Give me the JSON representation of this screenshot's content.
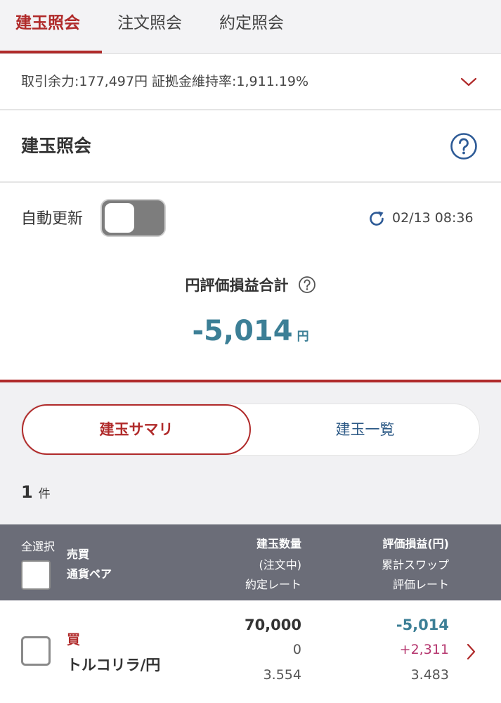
{
  "tabs": [
    {
      "label": "建玉照会",
      "active": true
    },
    {
      "label": "注文照会",
      "active": false
    },
    {
      "label": "約定照会",
      "active": false
    }
  ],
  "margin_info": "取引余力:177,497円 証拠金維持率:1,911.19%",
  "page_title": "建玉照会",
  "auto_update": {
    "label": "自動更新",
    "enabled": false
  },
  "timestamp": "02/13 08:36",
  "total_pl": {
    "label": "円評価損益合計",
    "value": "-5,014",
    "unit": "円"
  },
  "view_toggle": {
    "summary": "建玉サマリ",
    "list": "建玉一覧"
  },
  "count": {
    "value": "1",
    "unit": "件"
  },
  "table_header": {
    "select_all": "全選択",
    "side": "売買",
    "pair": "通貨ペア",
    "qty": "建玉数量",
    "pending": "(注文中)",
    "contract_rate": "約定レート",
    "pl": "評価損益(円)",
    "swap": "累計スワップ",
    "eval_rate": "評価レート"
  },
  "rows": [
    {
      "side": "買",
      "pair": "トルコリラ/円",
      "qty": "70,000",
      "pending": "0",
      "contract_rate": "3.554",
      "pl": "-5,014",
      "swap": "+2,311",
      "eval_rate": "3.483"
    }
  ],
  "colors": {
    "brand_red": "#b02a2a",
    "value_teal": "#3c7f96",
    "swap_pink": "#b5356e",
    "header_gray": "#6b6d78"
  }
}
